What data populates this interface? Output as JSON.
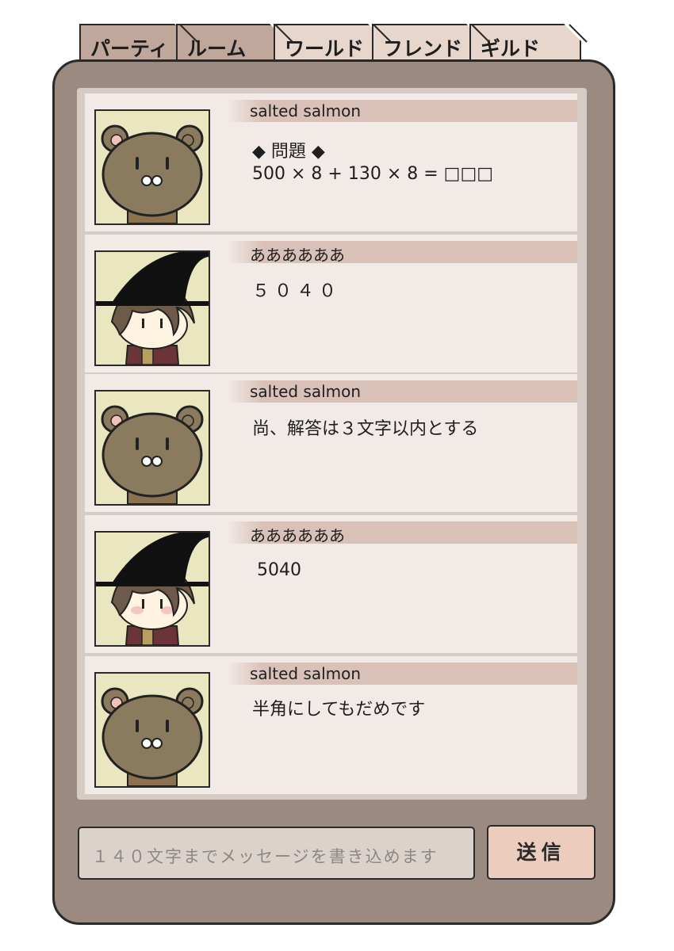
{
  "tabs": [
    {
      "label": "パーティ",
      "active": true
    },
    {
      "label": "ルーム",
      "active": false
    },
    {
      "label": "ワールド",
      "active": false
    },
    {
      "label": "フレンド",
      "active": false
    },
    {
      "label": "ギルド",
      "active": false
    }
  ],
  "messages": [
    {
      "sender": "salted salmon",
      "avatar": "bear-avatar",
      "text_line1": "◆ 問題 ◆",
      "text_line2": "500 × 8 + 130 × 8 = □□□"
    },
    {
      "sender": "ああああああ",
      "avatar": "witch-hat-avatar",
      "text": "５０４０"
    },
    {
      "sender": "salted salmon",
      "avatar": "bear-avatar",
      "text": "尚、解答は３文字以内とする"
    },
    {
      "sender": "ああああああ",
      "avatar": "witch-hat-avatar",
      "text": "5040"
    },
    {
      "sender": "salted salmon",
      "avatar": "bear-avatar",
      "text": "半角にしてもだめです"
    }
  ],
  "composer": {
    "placeholder": "１４０文字までメッセージを書き込めます",
    "send_label": "送信"
  },
  "colors": {
    "panel": "#9a8a80",
    "list_bg": "#d7ccc5",
    "message_bg": "#f2eae6",
    "name_bar": "#d9c1b7",
    "tab_active": "#bfa79b",
    "tab_inactive": "#e6d6cc",
    "send_button": "#ecccbd"
  }
}
